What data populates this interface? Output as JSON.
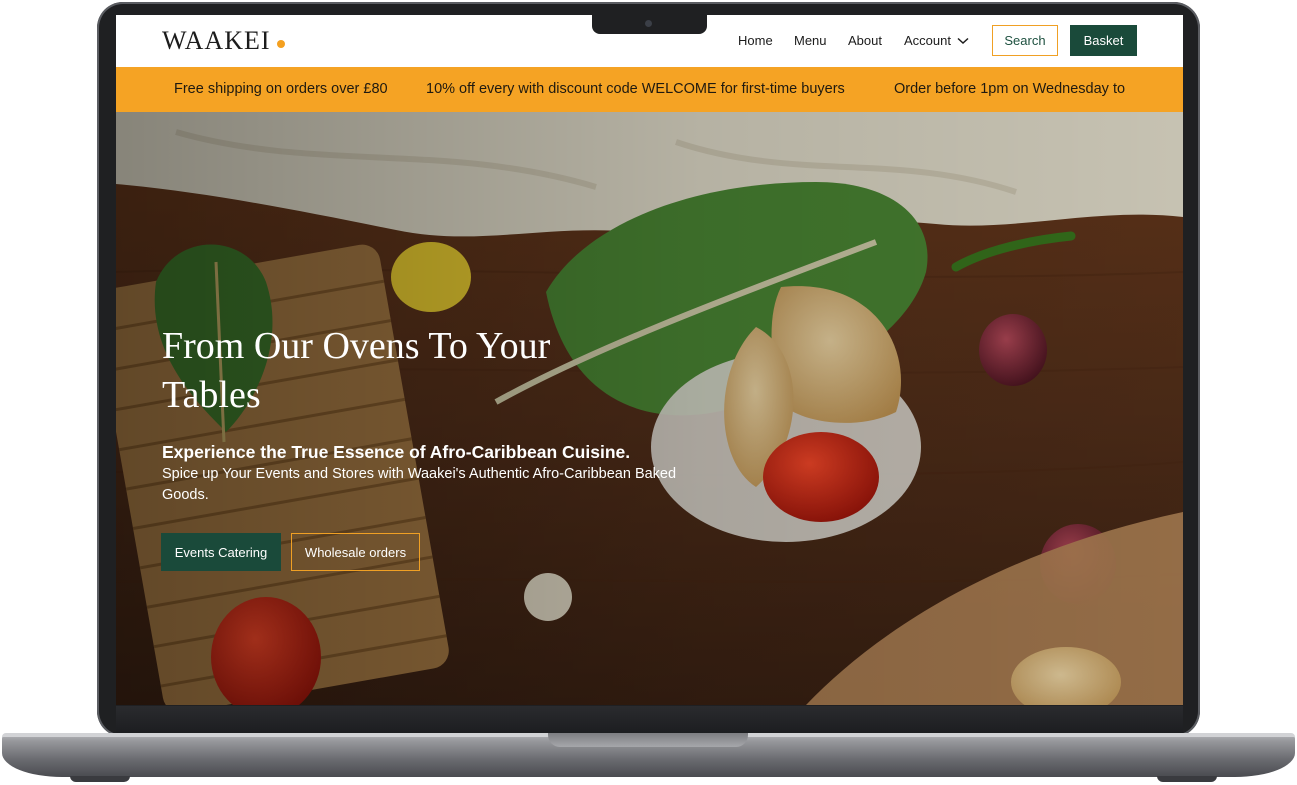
{
  "brand": {
    "name": "WAAKEI",
    "accent": "#f4a020",
    "primary": "#1a4a3a"
  },
  "nav": {
    "items": [
      "Home",
      "Menu",
      "About",
      "Account"
    ],
    "account_icon": "chevron-down-icon",
    "search_label": "Search",
    "basket_label": "Basket"
  },
  "promo": {
    "background": "#f5a324",
    "messages": [
      "Free shipping on orders over £80",
      "10% off every with discount code WELCOME for first-time buyers",
      "Order before 1pm on Wednesday to"
    ]
  },
  "hero": {
    "title": "From Our Ovens To Your Tables",
    "subtitle": "Experience the True Essence of Afro-Caribbean Cuisine.",
    "description": "Spice up Your Events and Stores with Waakei's Authentic Afro-Caribbean Baked Goods.",
    "primary_cta": "Events Catering",
    "secondary_cta": "Wholesale orders"
  }
}
